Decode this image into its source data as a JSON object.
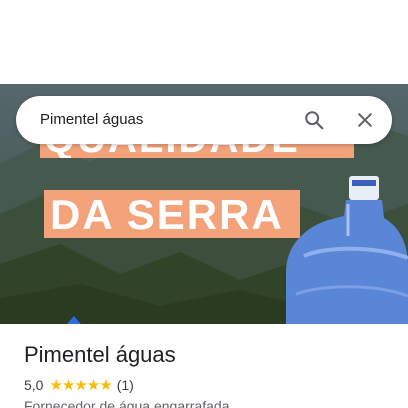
{
  "search": {
    "query": "Pimentel águas"
  },
  "hero": {
    "banner_top": "QUALIDADE",
    "banner_bottom": "DA SERRA"
  },
  "place": {
    "name": "Pimentel águas",
    "rating": "5,0",
    "stars": "★★★★★",
    "review_count": "(1)",
    "category": "Fornecedor de água engarrafada"
  },
  "icons": {
    "search": "search-icon",
    "close": "close-icon"
  },
  "colors": {
    "banner": "#f3a27a",
    "stars": "#fbbc04",
    "jug": "#5a86d8"
  }
}
